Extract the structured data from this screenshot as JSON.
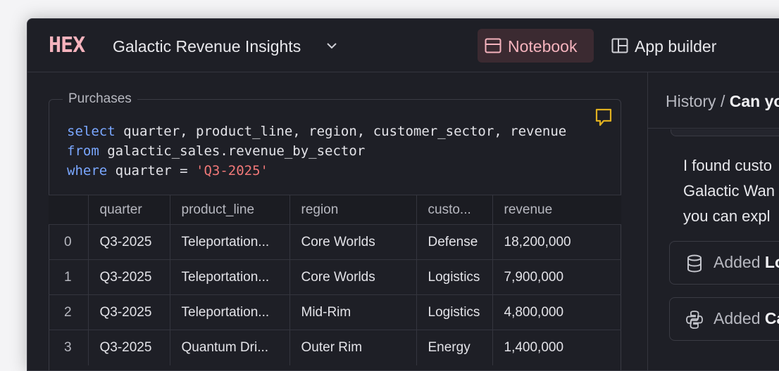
{
  "app": {
    "logo": "HEX",
    "project_title": "Galactic Revenue Insights"
  },
  "toolbar": {
    "notebook_label": "Notebook",
    "app_builder_label": "App builder"
  },
  "cell": {
    "label": "Purchases",
    "code": {
      "line1_kw": "select",
      "line1_rest": " quarter, product_line, region, customer_sector, revenue",
      "line2_kw": "from",
      "line2_rest": " galactic_sales.revenue_by_sector",
      "line3_kw": "where",
      "line3_mid": " quarter = ",
      "line3_str": "'Q3-2025'"
    }
  },
  "table": {
    "columns": [
      "",
      "quarter",
      "product_line",
      "region",
      "custo...",
      "revenue"
    ],
    "rows": [
      [
        "0",
        "Q3-2025",
        "Teleportation...",
        "Core Worlds",
        "Defense",
        "18,200,000"
      ],
      [
        "1",
        "Q3-2025",
        "Teleportation...",
        "Core Worlds",
        "Logistics",
        "7,900,000"
      ],
      [
        "2",
        "Q3-2025",
        "Teleportation...",
        "Mid-Rim",
        "Logistics",
        "4,800,000"
      ],
      [
        "3",
        "Q3-2025",
        "Quantum Dri...",
        "Outer Rim",
        "Energy",
        "1,400,000"
      ]
    ]
  },
  "panel": {
    "breadcrumb_prefix": "History / ",
    "breadcrumb_current": "Can yo",
    "message_lines": [
      "I found custo",
      "Galactic Wan",
      "you can expl"
    ],
    "actions": [
      {
        "prefix": "Added ",
        "name": "Lo",
        "icon": "database-icon"
      },
      {
        "prefix": "Added ",
        "name": "Ca",
        "icon": "python-icon"
      }
    ]
  },
  "colors": {
    "accent": "#f5b3bd",
    "background": "#1e1f26",
    "keyword": "#7aa7ff",
    "string": "#f07878"
  }
}
